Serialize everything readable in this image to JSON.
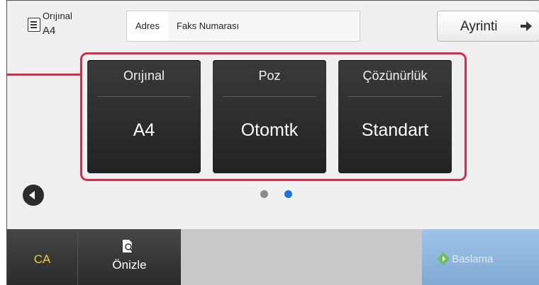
{
  "original": {
    "label": "Orıjınal",
    "size": "A4",
    "icon": "document-icon"
  },
  "address": {
    "label": "Adres",
    "field": "Faks Numarası"
  },
  "detail": {
    "label": "Ayrinti",
    "icon": "arrow-right-icon"
  },
  "tiles": [
    {
      "title": "Orıjınal",
      "value": "A4"
    },
    {
      "title": "Poz",
      "value": "Otomtk"
    },
    {
      "title": "Çözünürlük",
      "value": "Standart"
    }
  ],
  "pager": {
    "total_pages": 2,
    "current_page": 2
  },
  "bottom": {
    "ca_label": "CA",
    "preview_label": "Önizle",
    "start_label": "Baslama"
  },
  "colors": {
    "highlight": "#d42d4b",
    "active_dot": "#1e73d8",
    "ca_text": "#e3d23b",
    "start_button": "#8fb6de"
  }
}
